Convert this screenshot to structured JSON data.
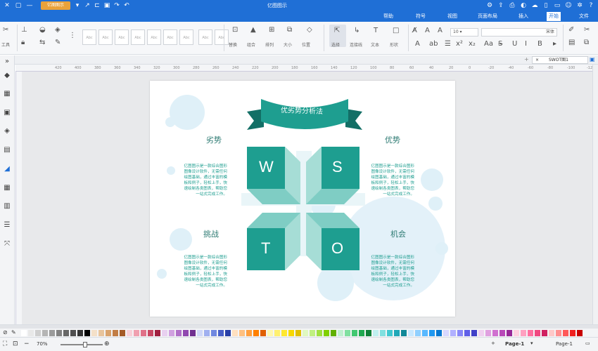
{
  "app": {
    "title": "亿图图示",
    "logo_label": "亿图图示"
  },
  "menu": {
    "file": "文件",
    "start": "开始",
    "insert": "插入",
    "page_layout": "页面布局",
    "view": "视图",
    "symbol": "符号",
    "help": "帮助"
  },
  "ribbon": {
    "select_label": "选择",
    "connector_label": "连接线",
    "text_label": "文本",
    "shape_label": "形状",
    "font_name": "宋体",
    "font_size": "10",
    "tools_label": "工具",
    "group_labels": [
      "替换",
      "组合",
      "排列",
      "大小",
      "位置",
      "对齐"
    ]
  },
  "doc_tab": {
    "label": "SWOT图1"
  },
  "ruler_ticks": [
    "-120",
    "-100",
    "-80",
    "-60",
    "-40",
    "-20",
    "0",
    "20",
    "40",
    "60",
    "80",
    "100",
    "120",
    "140",
    "160",
    "180",
    "200",
    "220",
    "240",
    "260",
    "280",
    "300",
    "320",
    "340",
    "360",
    "380",
    "400",
    "420"
  ],
  "diagram": {
    "banner_title": "优劣势分析法",
    "strengths": {
      "title": "优势",
      "letter": "S",
      "text": "亿图图示是一款综合图形图像设计软件，无需任何绘图基础，通过丰富的模板和例子，轻松上手，快速绘制各类图表，帮助您一站式完成工作。"
    },
    "weaknesses": {
      "title": "劣势",
      "letter": "W",
      "text": "亿图图示是一款综合图形图像设计软件，无需任何绘图基础，通过丰富的模板和例子，轻松上手，快速绘制各类图表，帮助您一站式完成工作。"
    },
    "opportunities": {
      "title": "机会",
      "letter": "O",
      "text": "亿图图示是一款综合图形图像设计软件，无需任何绘图基础，通过丰富的模板和例子，轻松上手，快速绘制各类图表，帮助您一站式完成工作。"
    },
    "threats": {
      "title": "挑战",
      "letter": "T",
      "text": "亿图图示是一款综合图形图像设计软件，无需任何绘图基础，通过丰富的模板和例子，轻松上手，快速绘制各类图表，帮助您一站式完成工作。"
    }
  },
  "status": {
    "page_selector": "Page-1",
    "page_tab": "Page-1",
    "zoom": "70%"
  },
  "colors": {
    "accent": "#1f6fd6",
    "teal": "#1e9e90",
    "teal_dark": "#136f66",
    "bubble": "#dff0f8"
  },
  "palette": [
    "#ffffff",
    "#e8e8e8",
    "#cfcfcf",
    "#b5b5b5",
    "#9b9b9b",
    "#828282",
    "#686868",
    "#4f4f4f",
    "#353535",
    "#000000",
    "#f4e0c8",
    "#e8c49c",
    "#d9a36e",
    "#c27d45",
    "#a45a26",
    "#f8d0d8",
    "#f0a0b0",
    "#e07088",
    "#c84864",
    "#a02040",
    "#e8d0f0",
    "#d0a0e0",
    "#b070c8",
    "#9048b0",
    "#703090",
    "#d0d8f8",
    "#a0b0f0",
    "#7088e0",
    "#4860c8",
    "#2840a8",
    "#ffe0c0",
    "#ffc080",
    "#ffa040",
    "#ff8000",
    "#e06000",
    "#fff8b0",
    "#fff070",
    "#ffe830",
    "#f8d800",
    "#e0c000",
    "#e0f8c0",
    "#c0f080",
    "#a0e040",
    "#80d000",
    "#60b000",
    "#c0f0d0",
    "#80e0a0",
    "#40c870",
    "#20a850",
    "#108038",
    "#c0f0f0",
    "#80e0e0",
    "#40c8d0",
    "#20a8b8",
    "#108898",
    "#c8e8ff",
    "#90d0ff",
    "#58b8ff",
    "#2098f0",
    "#0878d0",
    "#d8d8ff",
    "#b0b0ff",
    "#8888f8",
    "#6060e8",
    "#4040c8",
    "#f0d0f0",
    "#e0a0e0",
    "#d070d0",
    "#b848b8",
    "#982898",
    "#ffd0e0",
    "#ffa0c0",
    "#ff70a0",
    "#f04880",
    "#d02060",
    "#ffc8c8",
    "#ff9090",
    "#ff5858",
    "#f02020",
    "#c80000"
  ]
}
